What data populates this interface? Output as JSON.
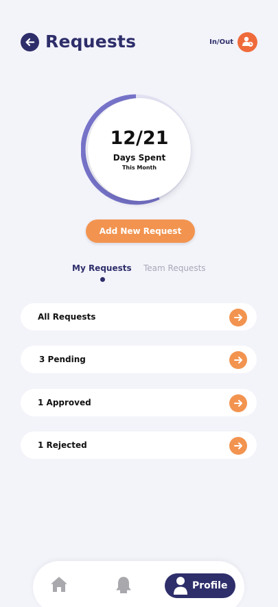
{
  "header": {
    "title": "Requests",
    "back_icon": "back-arrow-icon",
    "inout_label": "In/Out",
    "inout_icon": "user-clock-icon",
    "inout_color": "#ef6b3b"
  },
  "progress": {
    "value_text": "12/21",
    "label": "Days Spent",
    "sublabel": "This Month",
    "fraction": 0.571,
    "ring_color": "#7673c9"
  },
  "add_request_label": "Add New Request",
  "tabs": [
    {
      "label": "My Requests",
      "active": true
    },
    {
      "label": "Team Requests",
      "active": false
    }
  ],
  "request_items": [
    {
      "label": "All Requests"
    },
    {
      "label": "3 Pending"
    },
    {
      "label": "1 Approved"
    },
    {
      "label": "1 Rejected"
    }
  ],
  "bottom_nav": {
    "home_icon": "home-icon",
    "notifications_icon": "bell-icon",
    "profile_label": "Profile",
    "profile_icon": "user-icon"
  },
  "colors": {
    "primary": "#2e2e6b",
    "accent": "#f29450",
    "background": "#f3f3fa"
  }
}
